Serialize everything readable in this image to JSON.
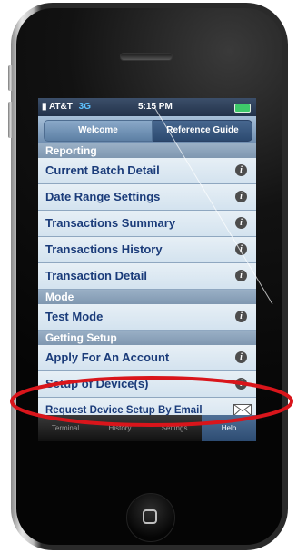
{
  "status_bar": {
    "carrier": "AT&T",
    "network": "3G",
    "time": "5:15 PM"
  },
  "top_tabs": [
    {
      "label": "Welcome"
    },
    {
      "label": "Reference Guide"
    }
  ],
  "sections": {
    "reporting": {
      "header": "Reporting",
      "items": [
        {
          "label": "Current Batch Detail"
        },
        {
          "label": "Date Range Settings"
        },
        {
          "label": "Transactions Summary"
        },
        {
          "label": "Transactions History"
        },
        {
          "label": "Transaction Detail"
        }
      ]
    },
    "mode": {
      "header": "Mode",
      "items": [
        {
          "label": "Test Mode"
        }
      ]
    },
    "getting_setup": {
      "header": "Getting Setup",
      "items": [
        {
          "label": "Apply For An Account"
        },
        {
          "label": "Setup of Device(s)"
        },
        {
          "label": "Request Device Setup By Email"
        }
      ]
    }
  },
  "bottom_tabs": [
    {
      "label": "Terminal"
    },
    {
      "label": "History"
    },
    {
      "label": "Settings"
    },
    {
      "label": "Help"
    }
  ],
  "colors": {
    "highlight": "#d9151b",
    "link_text": "#1b3c7a"
  }
}
